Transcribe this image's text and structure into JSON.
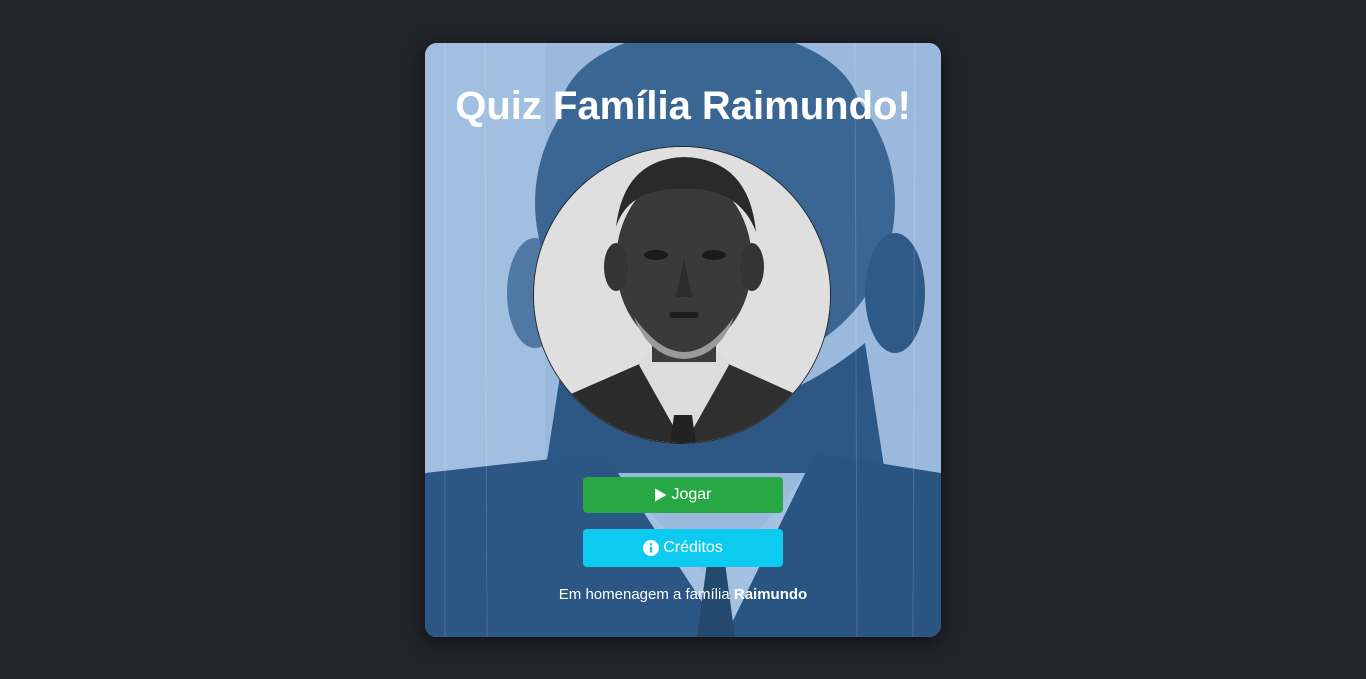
{
  "page": {
    "background_color": "#212429"
  },
  "card": {
    "title": "Quiz Família Raimundo!",
    "background_tint": "#9ab9dd",
    "portrait_icon": "portrait-photo"
  },
  "buttons": {
    "play": {
      "label": "Jogar",
      "icon": "play-icon",
      "color": "#28a745"
    },
    "credits": {
      "label": "Créditos",
      "icon": "info-circle-icon",
      "color": "#0dcaf0"
    }
  },
  "footer": {
    "text": "Em homenagem a família",
    "name": "Raimundo"
  }
}
